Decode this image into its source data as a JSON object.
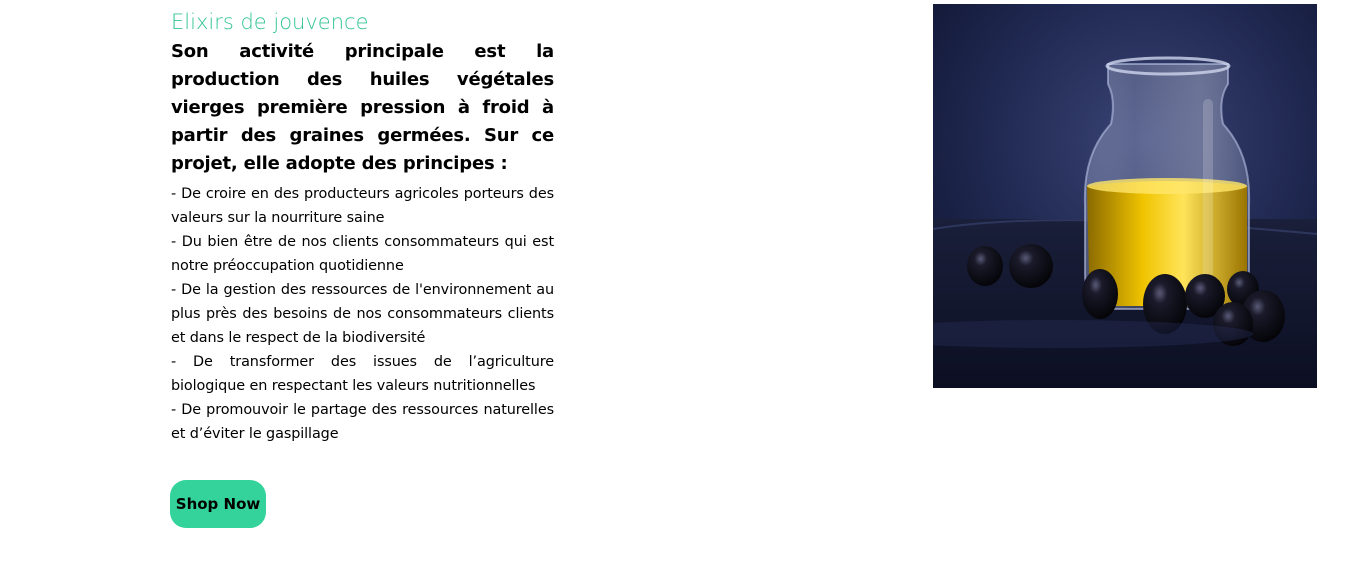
{
  "section": {
    "title": "Elixirs de jouvence",
    "lead": "Son activité principale est la production des huiles végétales vierges première pression à froid à partir des graines germées. Sur ce projet, elle adopte des principes :",
    "points": [
      "- De croire en des producteurs agricoles porteurs des valeurs sur la nourriture saine",
      "- Du bien être de nos clients consommateurs qui est notre préoccupation quotidienne",
      "- De la gestion des ressources de l'environnement au plus près des besoins de nos consommateurs clients et dans le respect de la biodiversité",
      "- De transformer des issues de l’agriculture biologique en respectant les valeurs nutritionnelles",
      "- De promouvoir le partage des ressources naturelles et d’éviter le gaspillage"
    ],
    "button_label": "Shop Now",
    "image_description_icon": "olive-oil-jar-photo"
  },
  "colors": {
    "accent": "#33c494",
    "button": "#33d39b",
    "text": "#000000"
  }
}
